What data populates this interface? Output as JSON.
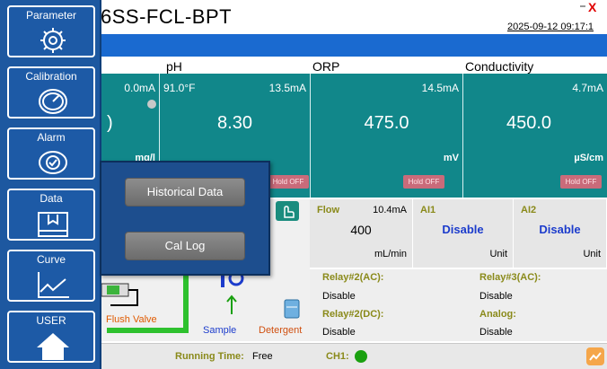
{
  "header": {
    "title": "6SS-FCL-BPT",
    "datetime": "2025-09-12 09:17:1"
  },
  "sidebar": {
    "items": [
      {
        "label": "Parameter",
        "icon": "gear-icon"
      },
      {
        "label": "Calibration",
        "icon": "gauge-icon"
      },
      {
        "label": "Alarm",
        "icon": "alarm-icon"
      },
      {
        "label": "Data",
        "icon": "data-icon"
      },
      {
        "label": "Curve",
        "icon": "curve-icon"
      },
      {
        "label": "USER",
        "icon": "home-icon"
      }
    ]
  },
  "popup": {
    "buttons": [
      "Historical Data",
      "Cal Log"
    ]
  },
  "panels": {
    "left": {
      "ma": "0.0mA",
      "value": ")",
      "unit": "mg/l"
    },
    "ph": {
      "label": "pH",
      "temp": "91.0°F",
      "ma": "13.5mA",
      "value": "8.30",
      "hold": "Hold OFF"
    },
    "orp": {
      "label": "ORP",
      "ma": "14.5mA",
      "value": "475.0",
      "unit": "mV",
      "hold": "Hold OFF"
    },
    "cond": {
      "label": "Conductivity",
      "ma": "4.7mA",
      "value": "450.0",
      "unit": "µS/cm",
      "hold": "Hold OFF"
    }
  },
  "info": {
    "flow": {
      "title": "Flow",
      "ma": "10.4mA",
      "value": "400",
      "unit": "mL/min"
    },
    "ai1": {
      "title": "AI1",
      "value": "Disable",
      "unit": "Unit"
    },
    "ai2": {
      "title": "AI2",
      "value": "Disable",
      "unit": "Unit"
    }
  },
  "relays": {
    "r2ac": "Relay#2(AC):",
    "r2ac_val": "Disable",
    "r3ac": "Relay#3(AC):",
    "r3ac_val": "Disable",
    "r2dc": "Relay#2(DC):",
    "r2dc_val": "Disable",
    "analog": "Analog:",
    "analog_val": "Disable"
  },
  "diagram": {
    "flush_valve": "Flush Valve",
    "sample": "Sample",
    "detergent": "Detergent"
  },
  "footer": {
    "running_label": "Running Time:",
    "running_value": "Free",
    "ch1_label": "CH1:"
  },
  "colors": {
    "sidebar": "#1d58a0",
    "header_bar": "#1a6ad0",
    "panel_teal": "#11878a",
    "label_olive": "#8a8a1a",
    "status_green": "#1aa010"
  }
}
